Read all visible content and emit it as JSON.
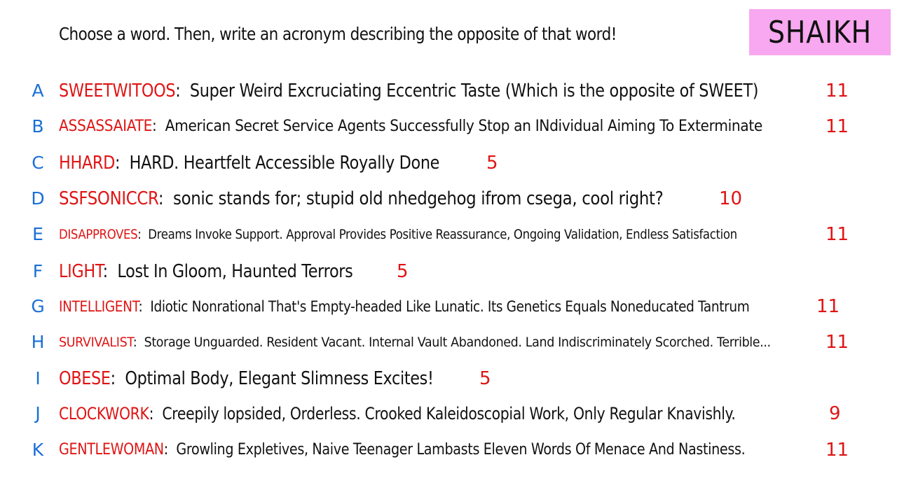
{
  "header": {
    "instruction": "Choose a word. Then, write an acronym describing the opposite of that word!",
    "name": "SHAIKH"
  },
  "colors": {
    "letter": "#1b6fd6",
    "word": "#e01414",
    "count": "#e01414",
    "name_tag_bg": "#f7a8f0"
  },
  "entries": [
    {
      "letter": "A",
      "word": "SWEETWITOOS",
      "definition": "Super Weird Excruciating Eccentric Taste (Which is the opposite of SWEET)",
      "count": "11"
    },
    {
      "letter": "B",
      "word": "ASSASSAIATE",
      "definition": "American Secret Service Agents Successfully Stop an INdividual Aiming To Exterminate",
      "count": "11"
    },
    {
      "letter": "C",
      "word": "HHARD",
      "definition": "HARD. Heartfelt Accessible Royally Done",
      "count": "5"
    },
    {
      "letter": "D",
      "word": "SSFSONICCR",
      "definition": "sonic stands for; stupid old nhedgehog ifrom csega, cool right?",
      "count": "10"
    },
    {
      "letter": "E",
      "word": "DISAPPROVES",
      "definition": "Dreams Invoke Support. Approval Provides Positive Reassurance, Ongoing Validation, Endless Satisfaction",
      "count": "11"
    },
    {
      "letter": "F",
      "word": "LIGHT",
      "definition": "Lost In Gloom, Haunted Terrors",
      "count": "5"
    },
    {
      "letter": "G",
      "word": "INTELLIGENT",
      "definition": "Idiotic Nonrational That's Empty-headed Like Lunatic. Its Genetics Equals Noneducated Tantrum",
      "count": "11"
    },
    {
      "letter": "H",
      "word": "SURVIVALIST",
      "definition": "Storage Unguarded. Resident Vacant. Internal Vault Abandoned. Land Indiscriminately Scorched. Terrible...",
      "count": "11"
    },
    {
      "letter": "I",
      "word": "OBESE",
      "definition": "Optimal Body, Elegant Slimness Excites!",
      "count": "5"
    },
    {
      "letter": "J",
      "word": "CLOCKWORK",
      "definition": "Creepily lopsided, Orderless. Crooked Kaleidoscopial Work, Only Regular Knavishly.",
      "count": "9"
    },
    {
      "letter": "K",
      "word": "GENTLEWOMAN",
      "definition": "Growling Expletives, Naive Teenager Lambasts Eleven Words Of Menace And Nastiness.",
      "count": "11"
    }
  ]
}
